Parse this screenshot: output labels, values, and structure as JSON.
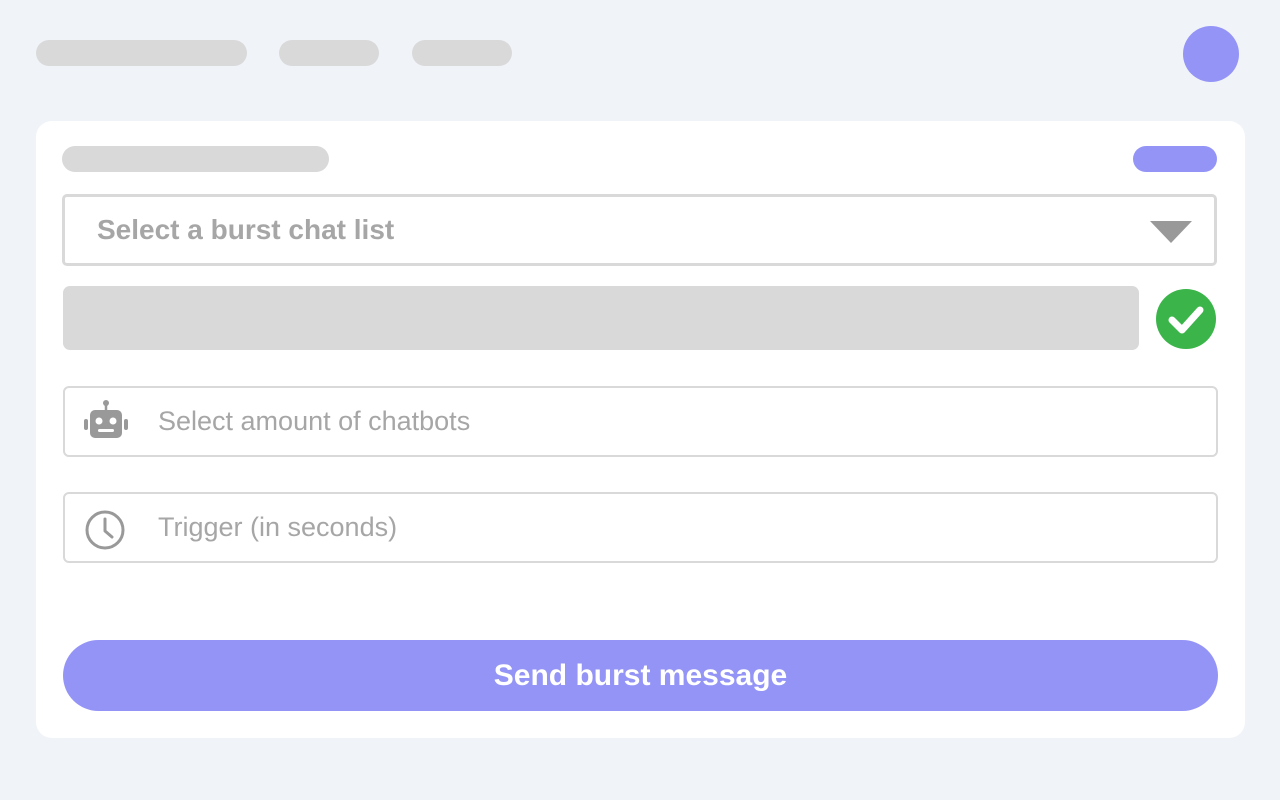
{
  "colors": {
    "background": "#f0f3f8",
    "card": "#ffffff",
    "accent": "#9494f7",
    "placeholder": "#d9d9d9",
    "muted_text": "#a6a6a6",
    "success": "#3bb54a"
  },
  "burst_form": {
    "list_select": {
      "label": "Select a burst chat list",
      "icon": "chevron-down-icon"
    },
    "status_icon": "check-circle-icon",
    "chatbots_field": {
      "placeholder": "Select amount of chatbots",
      "icon": "robot-icon"
    },
    "trigger_field": {
      "placeholder": "Trigger (in seconds)",
      "icon": "clock-icon"
    },
    "submit_label": "Send burst message"
  }
}
